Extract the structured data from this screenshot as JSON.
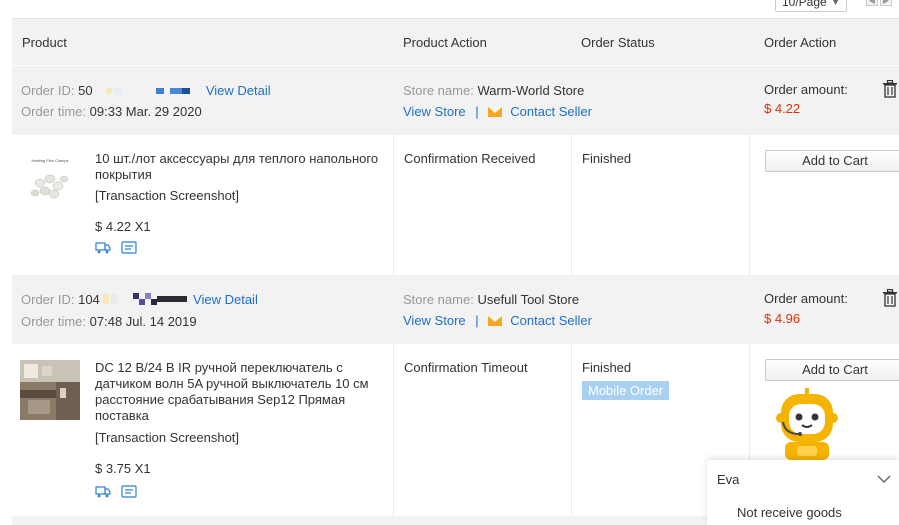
{
  "pagination": {
    "page_size": "10/Page"
  },
  "header": {
    "product": "Product",
    "product_action": "Product Action",
    "order_status": "Order Status",
    "order_action": "Order Action"
  },
  "labels": {
    "order_id": "Order ID:",
    "order_time": "Order time:",
    "store_name": "Store name:",
    "order_amount": "Order amount:",
    "view_detail": "View Detail",
    "view_store": "View Store",
    "separator": "|",
    "contact_seller": "Contact Seller",
    "transaction_screenshot": "[Transaction Screenshot]",
    "add_to_cart": "Add to Cart"
  },
  "orders": [
    {
      "id_prefix": "50",
      "time": "09:33 Mar. 29 2020",
      "store": "Warm-World Store",
      "amount": "$ 4.22",
      "product_name": "10 шт./лот аксессуары для теплого напольного покрытия",
      "price_qty": "$ 4.22 X1",
      "product_action": "Confirmation Received",
      "status": "Finished",
      "thumb_text": "Heating Film Clamps"
    },
    {
      "id_prefix": "104",
      "time": "07:48 Jul. 14 2019",
      "store": "Usefull Tool Store",
      "amount": "$ 4.96",
      "product_name": "DC 12 В/24 В IR ручной переключатель с датчиком волн 5A ручной выключатель 10 см расстояние срабатывания Sep12 Прямая поставка",
      "price_qty": "$ 3.75 X1",
      "product_action": "Confirmation Timeout",
      "status": "Finished",
      "badge": "Mobile Order"
    }
  ],
  "chat": {
    "agent_name": "Eva",
    "message": "Not receive goods"
  },
  "colors": {
    "link": "#1f6fc4",
    "amount": "#e62e04",
    "badge": "#a9cff1",
    "header_bg": "#f2f2f2"
  }
}
